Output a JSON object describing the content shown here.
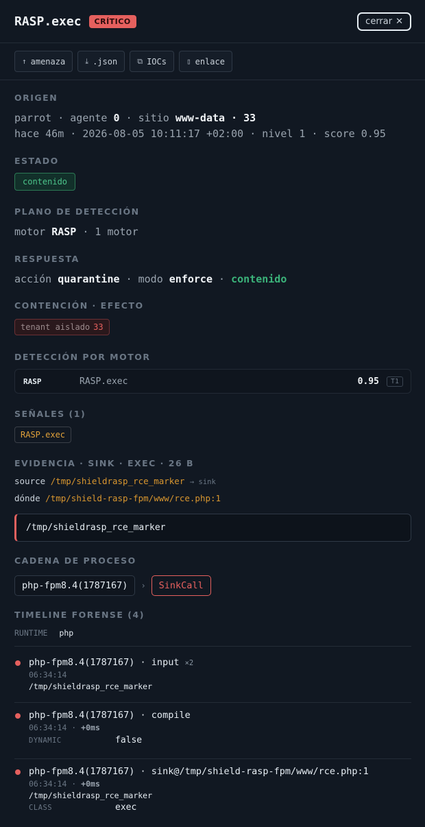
{
  "header": {
    "title": "RASP.exec",
    "severity": "CRÍTICO",
    "close_label": "cerrar",
    "close_icon": "✕"
  },
  "toolbar": {
    "buttons": [
      {
        "icon": "↑",
        "label": "amenaza"
      },
      {
        "icon": "⤓",
        "label": ".json"
      },
      {
        "icon": "⧉",
        "label": "IOCs"
      },
      {
        "icon": "▯",
        "label": "enlace"
      }
    ]
  },
  "origin": {
    "label": "ORIGEN",
    "host": "parrot",
    "sep": "·",
    "agent_word": "agente",
    "agent": "0",
    "site_word": "sitio",
    "site": "www-data · 33",
    "ago": "hace 46m",
    "timestamp": "2026-08-05 10:11:17 +02:00",
    "level": "nivel 1",
    "score": "score 0.95"
  },
  "state": {
    "label": "ESTADO",
    "value": "contenido"
  },
  "detection_plane": {
    "label": "PLANO DE DETECCIÓN",
    "motor_word": "motor",
    "motor": "RASP",
    "count": "1 motor"
  },
  "response": {
    "label": "RESPUESTA",
    "action_word": "acción",
    "action": "quarantine",
    "mode_word": "modo",
    "mode": "enforce",
    "status": "contenido"
  },
  "containment": {
    "label": "CONTENCIÓN · EFECTO",
    "text": "tenant aislado",
    "value": "33"
  },
  "engines": {
    "label": "DETECCIÓN POR MOTOR",
    "rows": [
      {
        "engine": "RASP",
        "rule": "RASP.exec",
        "score": "0.95",
        "tier": "T1"
      }
    ]
  },
  "signals": {
    "label": "SEÑALES (1)",
    "items": [
      "RASP.exec"
    ]
  },
  "evidence": {
    "label": "EVIDENCIA · SINK · EXEC · 26 B",
    "source_key": "source",
    "source": "/tmp/shieldrasp_rce_marker",
    "source_hint": "→ sink",
    "where_key": "dónde",
    "where": "/tmp/shield-rasp-fpm/www/rce.php:1",
    "payload": "/tmp/shieldrasp_rce_marker"
  },
  "process_chain": {
    "label": "CADENA DE PROCESO",
    "process": "php-fpm8.4(1787167)",
    "arrow": "›",
    "sink": "SinkCall"
  },
  "timeline": {
    "label": "TIMELINE FORENSE (4)",
    "runtime_key": "RUNTIME",
    "runtime_val": "php",
    "events": [
      {
        "title": "php-fpm8.4(1787167) · input",
        "mult": "×2",
        "time": "06:34:14",
        "delta": "",
        "path": "/tmp/shieldrasp_rce_marker",
        "kv_key": "",
        "kv_val": ""
      },
      {
        "title": "php-fpm8.4(1787167) · compile",
        "mult": "",
        "time": "06:34:14 · ",
        "delta": "+0ms",
        "path": "",
        "kv_key": "DYNAMIC",
        "kv_val": "false"
      },
      {
        "title": "php-fpm8.4(1787167) · sink@/tmp/shield-rasp-fpm/www/rce.php:1",
        "mult": "",
        "time": "06:34:14 · ",
        "delta": "+0ms",
        "path": "/tmp/shieldrasp_rce_marker",
        "kv_key": "CLASS",
        "kv_val": "exec"
      }
    ]
  }
}
